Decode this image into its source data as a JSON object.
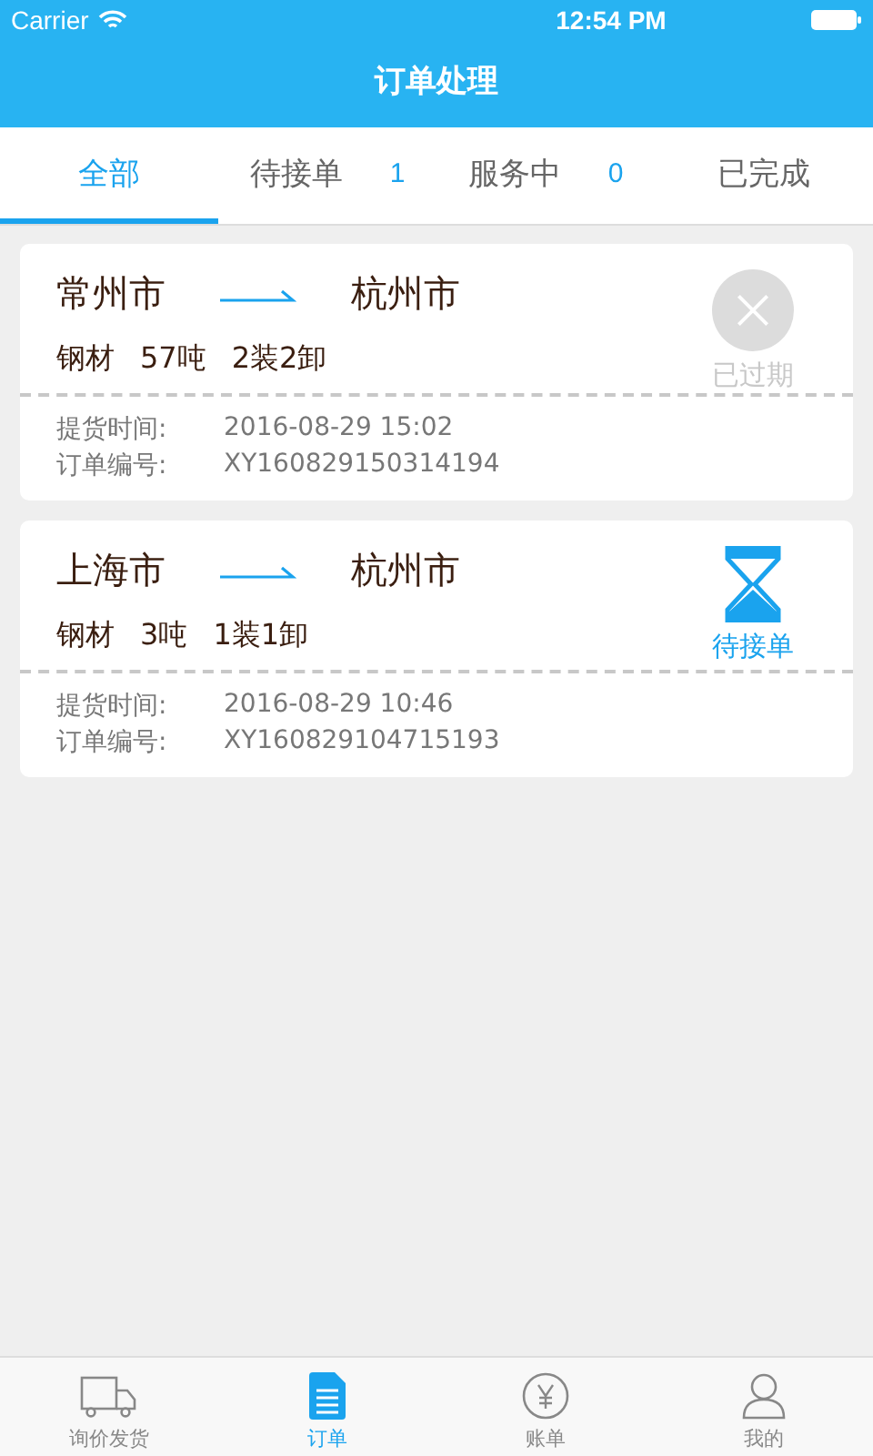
{
  "status_bar": {
    "carrier": "Carrier",
    "time": "12:54 PM"
  },
  "nav": {
    "title": "订单处理"
  },
  "tabs": [
    {
      "label": "全部",
      "selected": true
    },
    {
      "label": "待接单",
      "count": "1",
      "selected": false
    },
    {
      "label": "服务中",
      "count": "0",
      "selected": false
    },
    {
      "label": "已完成",
      "selected": false
    }
  ],
  "orders": [
    {
      "from": "常州市",
      "to": "杭州市",
      "goods": "钢材",
      "weight": "57吨",
      "stops": "2装2卸",
      "status": {
        "kind": "expired",
        "label": "已过期"
      },
      "pickup_label": "提货时间:",
      "pickup_time": "2016-08-29 15:02",
      "number_label": "订单编号:",
      "number": "XY160829150314194"
    },
    {
      "from": "上海市",
      "to": "杭州市",
      "goods": "钢材",
      "weight": "3吨",
      "stops": "1装1卸",
      "status": {
        "kind": "pending",
        "label": "待接单"
      },
      "pickup_label": "提货时间:",
      "pickup_time": "2016-08-29 10:46",
      "number_label": "订单编号:",
      "number": "XY160829104715193"
    }
  ],
  "tab_bar": [
    {
      "kind": "truck",
      "label": "询价发货",
      "selected": false
    },
    {
      "kind": "document",
      "label": "订单",
      "selected": true
    },
    {
      "kind": "bill",
      "label": "账单",
      "selected": false
    },
    {
      "kind": "person",
      "label": "我的",
      "selected": false
    }
  ]
}
